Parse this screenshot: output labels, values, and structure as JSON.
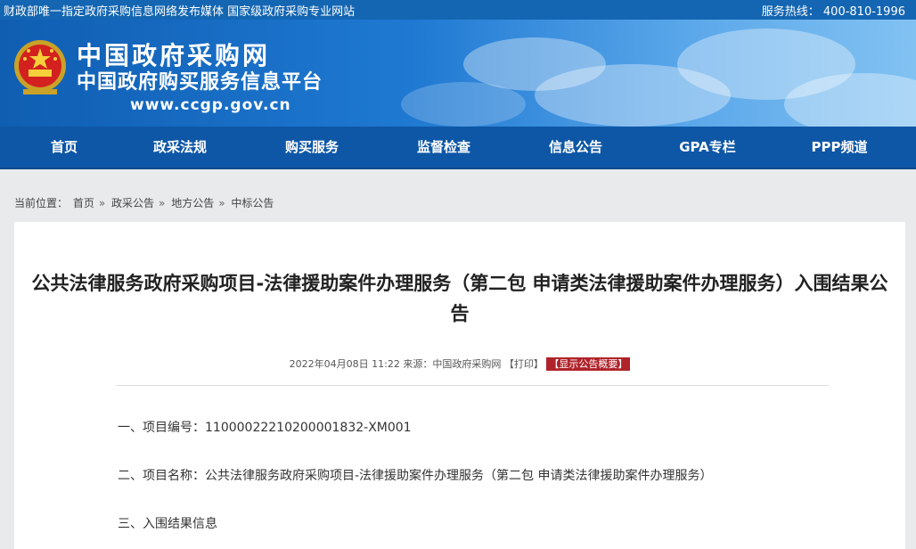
{
  "topbar": {
    "left_text": "财政部唯一指定政府采购信息网络发布媒体  国家级政府采购专业网站",
    "hotline": "服务热线：  400-810-1996"
  },
  "header": {
    "title": "中国政府采购网",
    "subtitle": "中国政府购买服务信息平台",
    "url": "www.ccgp.gov.cn"
  },
  "nav": {
    "items": [
      "首页",
      "政采法规",
      "购买服务",
      "监督检查",
      "信息公告",
      "GPA专栏",
      "PPP频道"
    ]
  },
  "breadcrumb": {
    "prefix": "当前位置：",
    "items": [
      "首页",
      "政采公告",
      "地方公告",
      "中标公告"
    ]
  },
  "article": {
    "title": "公共法律服务政府采购项目-法律援助案件办理服务（第二包 申请类法律援助案件办理服务）入围结果公告",
    "meta": "2022年04月08日 11:22 来源：中国政府采购网",
    "print": "【打印】",
    "summary": "【显示公告概要】",
    "items": [
      "一、项目编号：11000022210200001832-XM001",
      "二、项目名称：公共法律服务政府采购项目-法律援助案件办理服务（第二包 申请类法律援助案件办理服务）",
      "三、入围结果信息"
    ]
  },
  "colors": {
    "topbar": "#1466b2",
    "nav": "#0e57a6",
    "accent_red": "#b0232a"
  }
}
